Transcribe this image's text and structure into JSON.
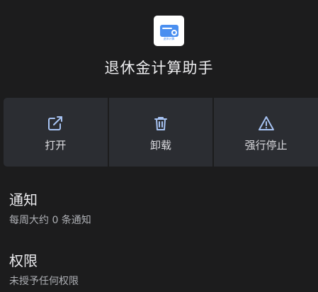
{
  "app": {
    "name": "退休金计算助手",
    "icon_caption": "退休计算",
    "icon_color": "#4a8ff0"
  },
  "actions": [
    {
      "label": "打开",
      "icon": "open-in-new-icon"
    },
    {
      "label": "卸载",
      "icon": "trash-icon"
    },
    {
      "label": "强行停止",
      "icon": "warning-icon"
    }
  ],
  "notifications": {
    "title": "通知",
    "subtitle": "每周大约 0 条通知"
  },
  "permissions": {
    "title": "权限",
    "subtitle": "未授予任何权限"
  },
  "colors": {
    "background": "#1c1c1d",
    "button_background": "#2b2d32",
    "text_primary": "#ececef",
    "text_secondary": "#aeb0b5"
  }
}
